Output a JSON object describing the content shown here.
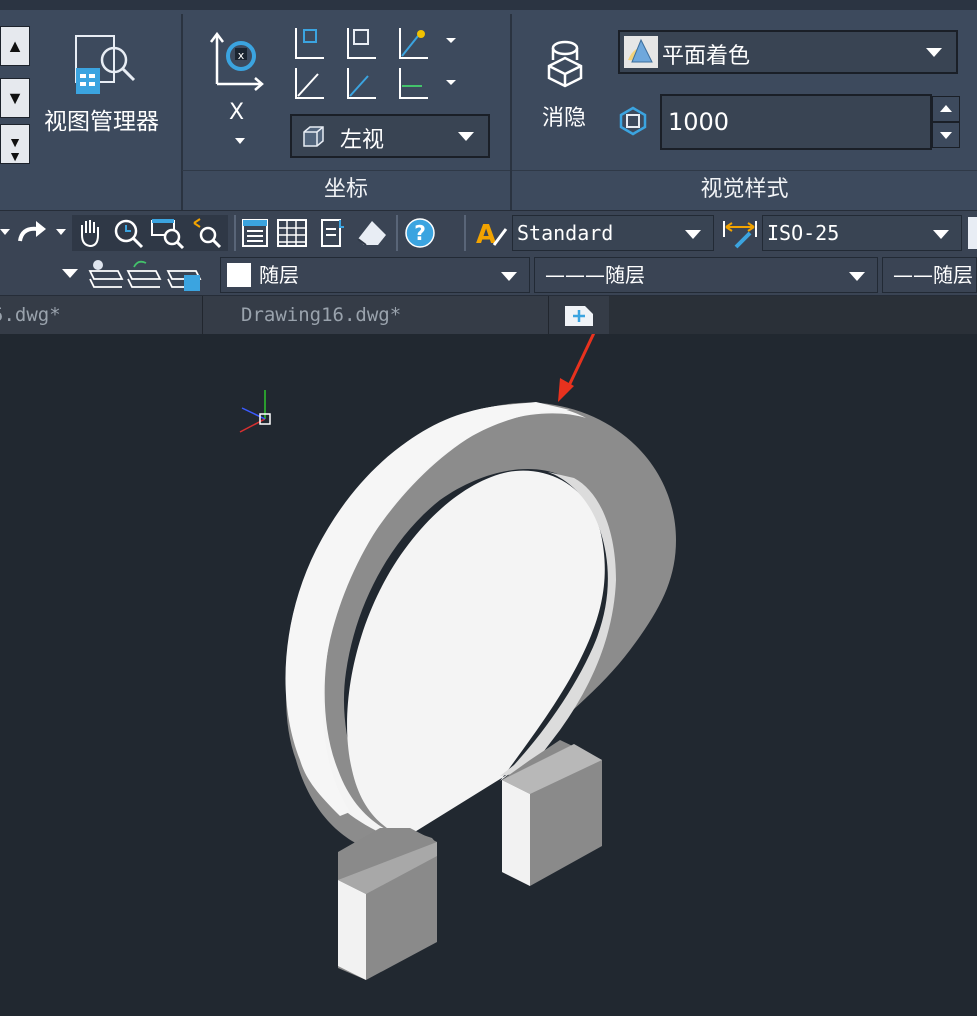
{
  "ribbon": {
    "view_manager_label": "视图管理器",
    "rotate_axis_label": "X",
    "view_select_value": "左视",
    "hide_label": "消隐",
    "visual_style_value": "平面着色",
    "facet_value": "1000",
    "panels": {
      "coordinates_title": "坐标",
      "visual_styles_title": "视觉样式"
    }
  },
  "toolbar": {
    "text_style_value": "Standard",
    "dim_style_value": "ISO-25"
  },
  "properties": {
    "color_value": "随层",
    "linetype_value": "———随层",
    "lineweight_value": "——随层"
  },
  "tabs": [
    {
      "label": "5.dwg*"
    },
    {
      "label": "Drawing16.dwg*"
    }
  ],
  "colors": {
    "ribbon_bg": "#3d4a5d",
    "canvas_bg": "#212830",
    "annotation_arrow": "#e8321e",
    "model_light": "#f6f6f6",
    "model_dark": "#8a8a8a"
  },
  "icons": [
    "up-arrow-icon",
    "down-arrow-icon",
    "expand-icon",
    "view-manager-icon",
    "rotate-x-icon",
    "ucs-icon",
    "box-view-icon",
    "hide-icon",
    "cone-style-icon",
    "facet-icon",
    "redo-icon",
    "pan-hand-icon",
    "zoom-realtime-icon",
    "zoom-window-icon",
    "zoom-previous-icon",
    "properties-icon",
    "table-icon",
    "document-icon",
    "eraser-icon",
    "help-icon",
    "text-style-icon",
    "dim-style-icon",
    "layer-states-icon",
    "new-tab-icon",
    "ucs-origin-icon",
    "annotation-arrow-icon"
  ]
}
